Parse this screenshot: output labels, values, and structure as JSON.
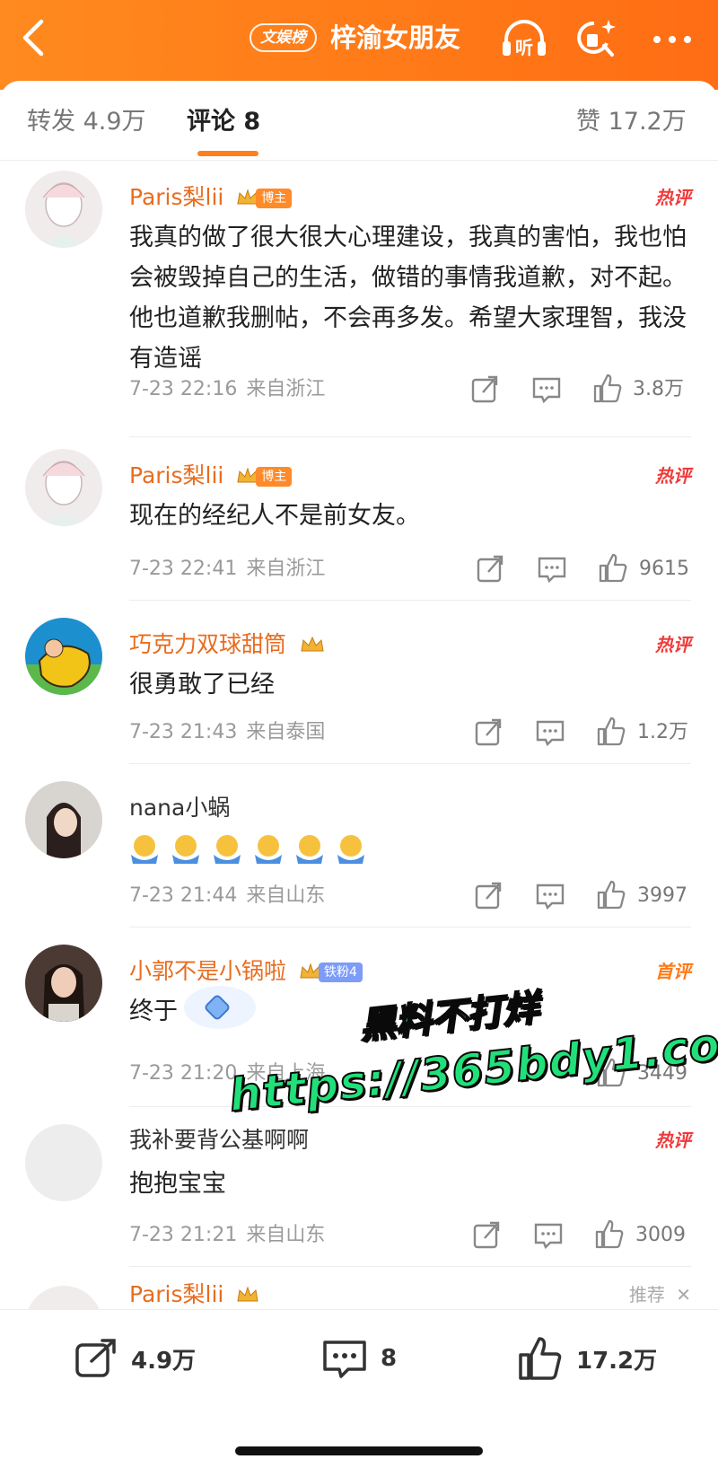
{
  "header": {
    "badge": "文娱榜",
    "title": "梓渝女朋友",
    "listen_label": "听"
  },
  "tabs": {
    "repost": "转发 4.9万",
    "comments": "评论 8",
    "likes": "赞 17.2万"
  },
  "comments": [
    {
      "user": "Paris梨lii",
      "role": "博主",
      "tag": "热评",
      "text": "我真的做了很大很大心理建设，我真的害怕，我也怕会被毁掉自己的生活，做错的事情我道歉，对不起。他也道歉我删帖，不会再多发。希望大家理智，我没有造谣",
      "time": "7-23 22:16",
      "location": "来自浙江",
      "likes": "3.8万"
    },
    {
      "user": "Paris梨lii",
      "role": "博主",
      "tag": "热评",
      "text": "现在的经纪人不是前女友。",
      "time": "7-23 22:41",
      "location": "来自浙江",
      "likes": "9615"
    },
    {
      "user": "巧克力双球甜筒",
      "tag": "热评",
      "text": "很勇敢了已经",
      "time": "7-23 21:43",
      "location": "来自泰国",
      "likes": "1.2万"
    },
    {
      "user": "nana小蜗",
      "text_emoji_count": 6,
      "time": "7-23 21:44",
      "location": "来自山东",
      "likes": "3997"
    },
    {
      "user": "小郭不是小锅啦",
      "role": "铁粉4",
      "tag": "首评",
      "text": "终于",
      "time": "7-23 21:20",
      "location": "来自上海",
      "likes": "3449"
    },
    {
      "user": "我补要背公基啊啊",
      "tag": "热评",
      "text": "抱抱宝宝",
      "time": "7-23 21:21",
      "location": "来自山东",
      "likes": "3009"
    },
    {
      "user": "Paris梨lii",
      "tag": "推荐"
    }
  ],
  "watermark": {
    "line1": "黑料不打烊",
    "line2": "https://365bdy1.com"
  },
  "bottom_bar": {
    "repost": "4.9万",
    "comment": "8",
    "like": "17.2万"
  },
  "colors": {
    "header_orange": "#ff7a18",
    "username_orange": "#e86c1f",
    "hot_red": "#f03a3a",
    "watermark_green": "#21e07a"
  }
}
